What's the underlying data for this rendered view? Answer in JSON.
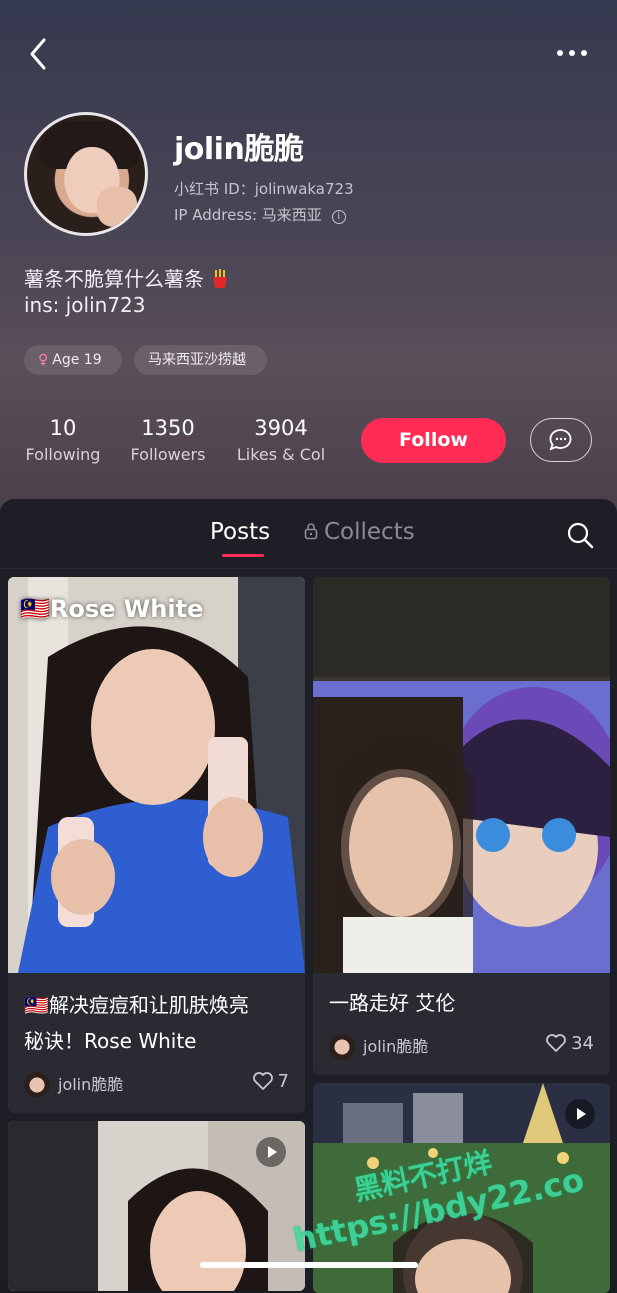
{
  "header": {
    "name": "jolin脆脆",
    "id_line": "小红书 ID：jolinwaka723",
    "ip_line": "IP Address: 马来西亚",
    "bio_line1": "薯条不脆算什么薯条",
    "bio_line2": "ins: jolin723",
    "tag_age": "Age 19",
    "tag_location": "马来西亚沙捞越"
  },
  "stats": [
    {
      "value": "10",
      "label": "Following"
    },
    {
      "value": "1350",
      "label": "Followers"
    },
    {
      "value": "3904",
      "label": "Likes & Col"
    }
  ],
  "actions": {
    "follow_label": "Follow"
  },
  "tabs": {
    "posts": "Posts",
    "collects": "Collects"
  },
  "posts": [
    {
      "overlay": "🇲🇾Rose White",
      "title_line1": "🇲🇾解决痘痘和让肌肤焕亮",
      "title_line2": "秘诀！Rose White",
      "author": "jolin脆脆",
      "likes": "7"
    },
    {
      "title_line1": "一路走好 艾伦",
      "author": "jolin脆脆",
      "likes": "34"
    }
  ],
  "watermark": {
    "line1": "黑料不打烊",
    "line2": "https://bdy22.co"
  },
  "colors": {
    "accent": "#fe2c55",
    "panel": "#1e1e26"
  }
}
